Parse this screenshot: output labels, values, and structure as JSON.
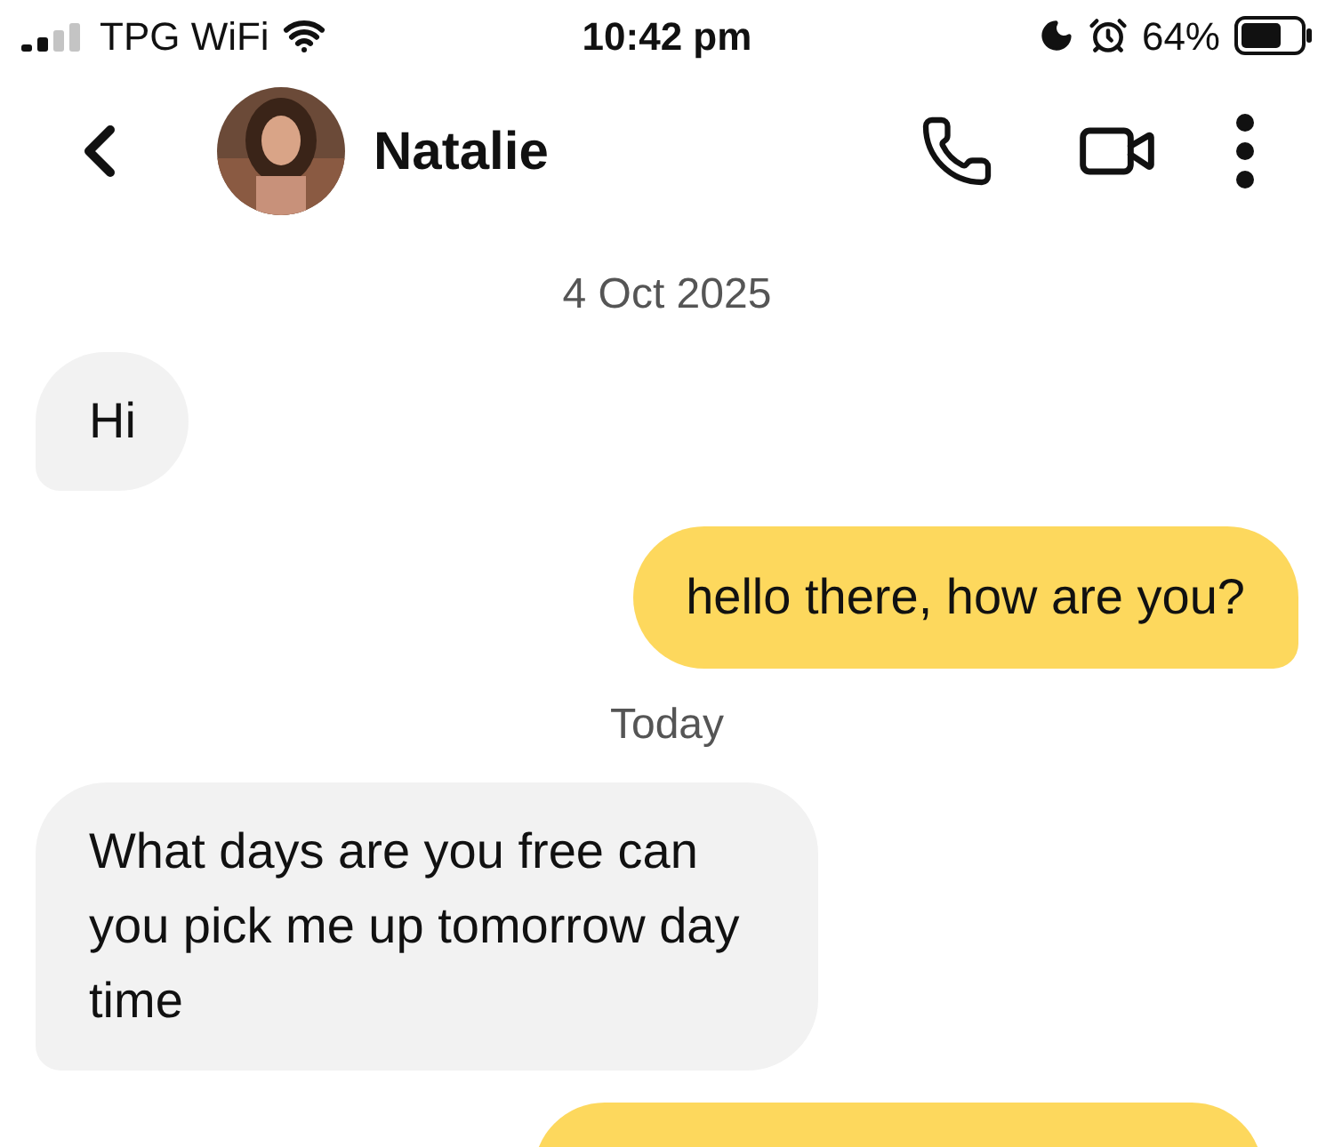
{
  "status_bar": {
    "carrier": "TPG WiFi",
    "time": "10:42 pm",
    "battery": "64%"
  },
  "header": {
    "name": "Natalie"
  },
  "messages": [
    {
      "kind": "date",
      "text": "4 Oct 2025"
    },
    {
      "kind": "received",
      "text": "Hi"
    },
    {
      "kind": "sent",
      "text": "hello there, how are you?"
    },
    {
      "kind": "date",
      "text": "Today"
    },
    {
      "kind": "received",
      "text": "What days are you free can you pick me up tomorrow day time"
    },
    {
      "kind": "sent_partial"
    }
  ]
}
